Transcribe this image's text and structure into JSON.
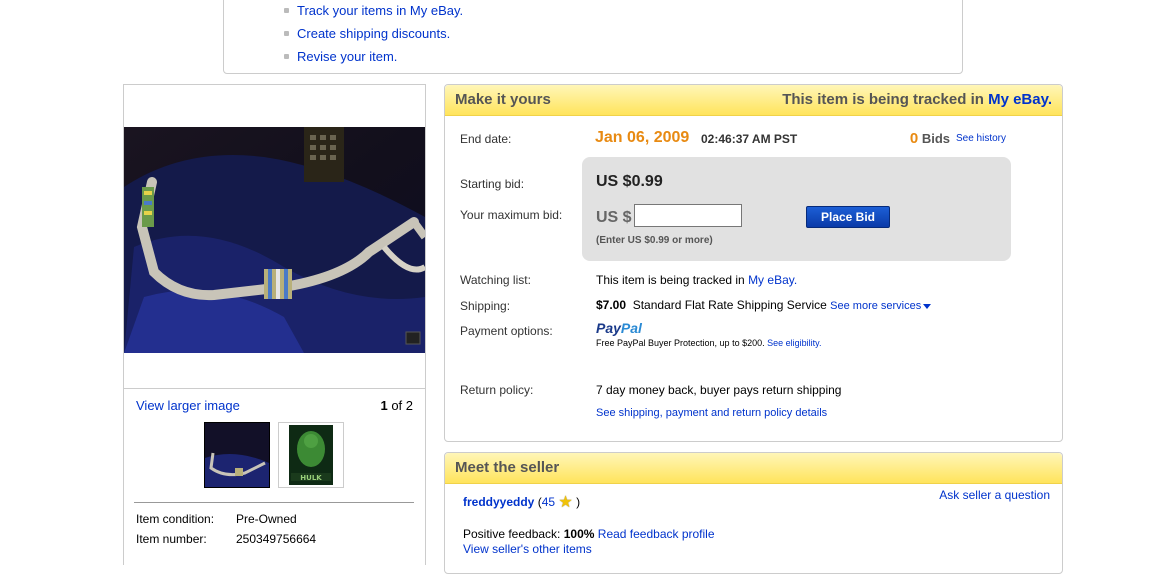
{
  "top_links": [
    "Track your items in My eBay.",
    "Create shipping discounts.",
    "Revise your item."
  ],
  "gallery": {
    "view_larger": "View larger image",
    "page_current": "1",
    "page_of": "of 2",
    "thumb2_caption": "HULK"
  },
  "item_details": [
    {
      "label": "Item condition:",
      "value": "Pre-Owned"
    },
    {
      "label": "Item number:",
      "value": "250349756664"
    }
  ],
  "make_it_yours": {
    "heading": "Make it yours",
    "tracked_prefix": "This item is being tracked in ",
    "tracked_link": "My eBay.",
    "end_date_label": "End date:",
    "end_date": "Jan 06, 2009",
    "end_time": "02:46:37 AM PST",
    "bids_count": "0",
    "bids_label": "Bids",
    "see_history": "See history",
    "starting_bid_label": "Starting bid:",
    "starting_bid": "US $0.99",
    "max_bid_label": "Your maximum bid:",
    "currency_prefix": "US $",
    "max_bid_value": "",
    "enter_hint": "(Enter US $0.99 or more)",
    "place_bid": "Place Bid",
    "watching_label": "Watching list:",
    "watching_text": "This item is being tracked in ",
    "watching_link": "My eBay.",
    "shipping_label": "Shipping:",
    "shipping_cost": "$7.00",
    "shipping_service": "Standard Flat Rate Shipping Service",
    "see_more_services": "See more services",
    "payment_label": "Payment options:",
    "paypal_a": "Pay",
    "paypal_b": "Pal",
    "paypal_protection": "Free PayPal Buyer Protection, up to $200.",
    "see_eligibility": "See eligibility.",
    "return_label": "Return policy:",
    "return_text": "7 day money back, buyer pays return shipping",
    "policy_link": "See shipping, payment and return policy details"
  },
  "meet_seller": {
    "heading": "Meet the seller",
    "seller_name": "freddyyeddy",
    "open_paren": "(",
    "feedback_score": "45",
    "close_paren": ")",
    "ask_question": "Ask seller a question",
    "positive_label": "Positive feedback:",
    "positive_value": "100%",
    "read_feedback": "Read feedback profile",
    "other_items": "View seller's other items"
  },
  "colors": {
    "link": "#0033cc",
    "accent_orange": "#e88a12",
    "panel_header": "#ffe45c"
  }
}
